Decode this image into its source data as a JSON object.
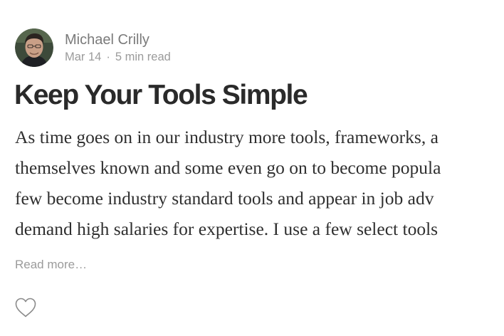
{
  "post": {
    "author": {
      "name": "Michael Crilly",
      "avatar_icon": "author-avatar-photo"
    },
    "date": "Mar 14",
    "separator": "·",
    "read_time": "5 min read",
    "title": "Keep Your Tools Simple",
    "excerpt_lines": [
      "As time goes on in our industry more tools, frameworks, a",
      "themselves known and some even go on to become popula",
      "few become industry standard tools and appear in job adv",
      "demand high salaries for expertise. I use a few select tools"
    ],
    "read_more_label": "Read more…",
    "like_icon": "heart-outline-icon"
  },
  "colors": {
    "title": "#2a2a2a",
    "body_text": "#2f2f2f",
    "meta_text": "#9b9b9b",
    "author_text": "#7a7a7a",
    "icon_stroke": "#8a8a8a"
  }
}
